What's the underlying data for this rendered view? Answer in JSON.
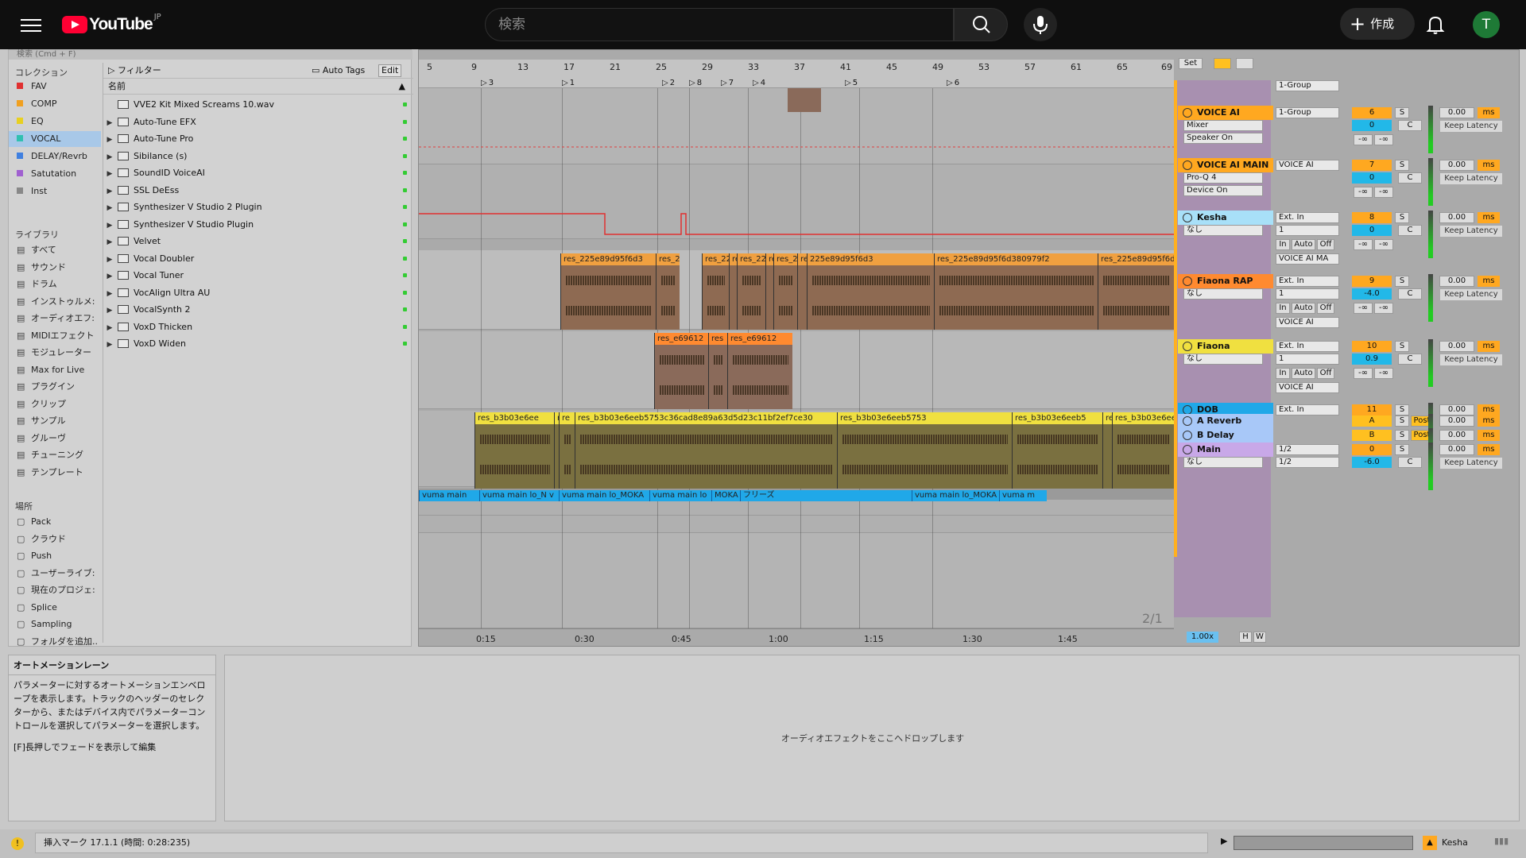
{
  "youtube": {
    "logo_text": "YouTube",
    "region": "JP",
    "search_placeholder": "検索",
    "create_label": "作成",
    "avatar_letter": "T",
    "colors": {
      "bg": "#0f0f0f",
      "logo_red": "#ff0033",
      "avatar": "#1e7a36"
    }
  },
  "browser": {
    "top_hint": "検索 (Cmd + F)",
    "collections_title": "コレクション",
    "collections": [
      {
        "label": "FAV",
        "color": "#e03030"
      },
      {
        "label": "COMP",
        "color": "#f0a020"
      },
      {
        "label": "EQ",
        "color": "#e8d020"
      },
      {
        "label": "VOCAL",
        "color": "#30c0b0"
      },
      {
        "label": "DELAY/Revrb",
        "color": "#4080e0"
      },
      {
        "label": "Satutation",
        "color": "#a060d0"
      },
      {
        "label": "Inst",
        "color": "#888888"
      }
    ],
    "library_title": "ライブラリ",
    "library": [
      {
        "label": "すべて",
        "icon": "bars-icon"
      },
      {
        "label": "サウンド",
        "icon": "note-icon"
      },
      {
        "label": "ドラム",
        "icon": "grid-icon"
      },
      {
        "label": "インストゥルメ:",
        "icon": "clock-icon"
      },
      {
        "label": "オーディオエフ:",
        "icon": "fx-icon"
      },
      {
        "label": "MIDIエフェクト",
        "icon": "midi-icon"
      },
      {
        "label": "モジュレーター",
        "icon": "mod-icon"
      },
      {
        "label": "Max for Live",
        "icon": "max-icon"
      },
      {
        "label": "プラグイン",
        "icon": "plug-icon"
      },
      {
        "label": "クリップ",
        "icon": "clip-icon"
      },
      {
        "label": "サンプル",
        "icon": "wave-icon"
      },
      {
        "label": "グルーヴ",
        "icon": "groove-icon"
      },
      {
        "label": "チューニング",
        "icon": "tuning-icon"
      },
      {
        "label": "テンプレート",
        "icon": "template-icon"
      }
    ],
    "places_title": "場所",
    "places": [
      {
        "label": "Pack",
        "icon": "pack-icon"
      },
      {
        "label": "クラウド",
        "icon": "cloud-icon"
      },
      {
        "label": "Push",
        "icon": "push-icon"
      },
      {
        "label": "ユーザーライブ:",
        "icon": "user-icon"
      },
      {
        "label": "現在のプロジェ:",
        "icon": "folder-icon"
      },
      {
        "label": "Splice",
        "icon": "folder-icon"
      },
      {
        "label": "Sampling",
        "icon": "folder-icon"
      },
      {
        "label": "フォルダを追加..",
        "icon": "add-folder-icon"
      }
    ],
    "filter_label": "フィルター",
    "autotags_label": "Auto Tags",
    "edit_label": "Edit",
    "name_header": "名前",
    "items": [
      "VVE2 Kit Mixed Screams 10.wav",
      "Auto-Tune EFX",
      "Auto-Tune Pro",
      "Sibilance (s)",
      "SoundID VoiceAI",
      "SSL DeEss",
      "Synthesizer V Studio 2 Plugin",
      "Synthesizer V Studio Plugin",
      "Velvet",
      "Vocal Doubler",
      "Vocal Tuner",
      "VocAlign Ultra AU",
      "VocalSynth 2",
      "VoxD Thicken",
      "VoxD Widen"
    ]
  },
  "arrangement": {
    "bars": [
      "5",
      "9",
      "13",
      "17",
      "21",
      "25",
      "29",
      "33",
      "37",
      "41",
      "45",
      "49",
      "53",
      "57",
      "61",
      "65",
      "69"
    ],
    "locators": [
      "3",
      "1",
      "2",
      "8",
      "7",
      "4",
      "5",
      "6"
    ],
    "set_label": "Set",
    "page_indicator": "2/1",
    "zoom": "1.00x",
    "h_label": "H",
    "w_label": "W",
    "times": [
      "0:15",
      "0:30",
      "0:45",
      "1:00",
      "1:15",
      "1:30",
      "1:45"
    ],
    "clips": {
      "kesha": [
        "res_225e89d95f6d3",
        "res_22",
        "res_22",
        "re",
        "res_22",
        "re",
        "res_225",
        "res",
        "225e89d95f6d3",
        "res_225e89d95f6d380979f2",
        "res_225e89d95f6d3809"
      ],
      "fiaona_rap": [
        "res_e69612",
        "res",
        "res_e69612"
      ],
      "fiaona": [
        "res_b3b03e6ee",
        "r",
        "re",
        "res_b3b03e6eeb5753c36cad8e89a63d5d23c11bf2ef7ce30",
        "res_b3b03e6eeb5753",
        "res_b3b03e6eeb5",
        "res_b3b0",
        "res_b3b03e6eeb5753c3"
      ],
      "dob": [
        "vuma main",
        "vuma main lo_N v",
        "vuma main lo_MOKA",
        "vuma main lo",
        "MOKA",
        "フリーズ",
        "vuma main lo_MOKA",
        "vuma m"
      ]
    }
  },
  "mixer": {
    "tracks": [
      {
        "name": "VOICE AI",
        "route": "1-Group",
        "num": "6",
        "vol": "0",
        "pan": "C",
        "device1": "Mixer",
        "device2": "Speaker On",
        "delay": "0.00",
        "unit": "ms",
        "latency": "Keep Latency",
        "color": "#ffa820"
      },
      {
        "name": "VOICE AI MAIN",
        "route": "VOICE AI",
        "num": "7",
        "vol": "0",
        "pan": "C",
        "device1": "Pro-Q 4",
        "device2": "Device On",
        "delay": "0.00",
        "unit": "ms",
        "latency": "Keep Latency",
        "color": "#ffa820"
      },
      {
        "name": "Kesha",
        "route": "Ext. In",
        "sub": "1",
        "num": "8",
        "vol": "0",
        "pan": "C",
        "device1": "なし",
        "out": "VOICE AI MA",
        "delay": "0.00",
        "unit": "ms",
        "latency": "Keep Latency",
        "color": "#a8e0f8"
      },
      {
        "name": "Fiaona RAP",
        "route": "Ext. In",
        "sub": "1",
        "num": "9",
        "vol": "-4.0",
        "pan": "C",
        "device1": "なし",
        "out": "VOICE AI",
        "delay": "0.00",
        "unit": "ms",
        "latency": "Keep Latency",
        "color": "#ff8a30"
      },
      {
        "name": "Fiaona",
        "route": "Ext. In",
        "sub": "1",
        "num": "10",
        "vol": "0.9",
        "pan": "C",
        "device1": "なし",
        "out": "VOICE AI",
        "delay": "0.00",
        "unit": "ms",
        "latency": "Keep Latency",
        "color": "#f0e040"
      },
      {
        "name": "DOB",
        "route": "Ext. In",
        "num": "11",
        "delay": "0.00",
        "unit": "ms",
        "color": "#20a8e8"
      },
      {
        "name": "A Reverb",
        "num": "A",
        "post": "Post",
        "delay": "0.00",
        "unit": "ms",
        "color": "#a8c8f8"
      },
      {
        "name": "B Delay",
        "num": "B",
        "post": "Post",
        "delay": "0.00",
        "unit": "ms",
        "color": "#a8c8f8"
      },
      {
        "name": "Main",
        "route": "1/2",
        "sub": "1/2",
        "num": "0",
        "vol": "-6.0",
        "pan": "C",
        "device1": "なし",
        "delay": "0.00",
        "unit": "ms",
        "latency": "Keep Latency",
        "color": "#c8a8e8"
      }
    ],
    "top_route": "1-Group",
    "in_label": "In",
    "auto_label": "Auto",
    "off_label": "Off",
    "s_label": "S",
    "neg_inf": "-∞"
  },
  "automation": {
    "title": "オートメーションレーン",
    "body": "パラメーターに対するオートメーションエンベロープを表示します。トラックのヘッダーのセレクターから、またはデバイス内でパラメーターコントロールを選択してパラメーターを選択します。",
    "hint": "[F]長押しでフェードを表示して編集"
  },
  "drop_hint": "オーディオエフェクトをここへドロップします",
  "status": {
    "text": "挿入マーク 17.1.1 (時間: 0:28:235)",
    "track": "Kesha"
  }
}
